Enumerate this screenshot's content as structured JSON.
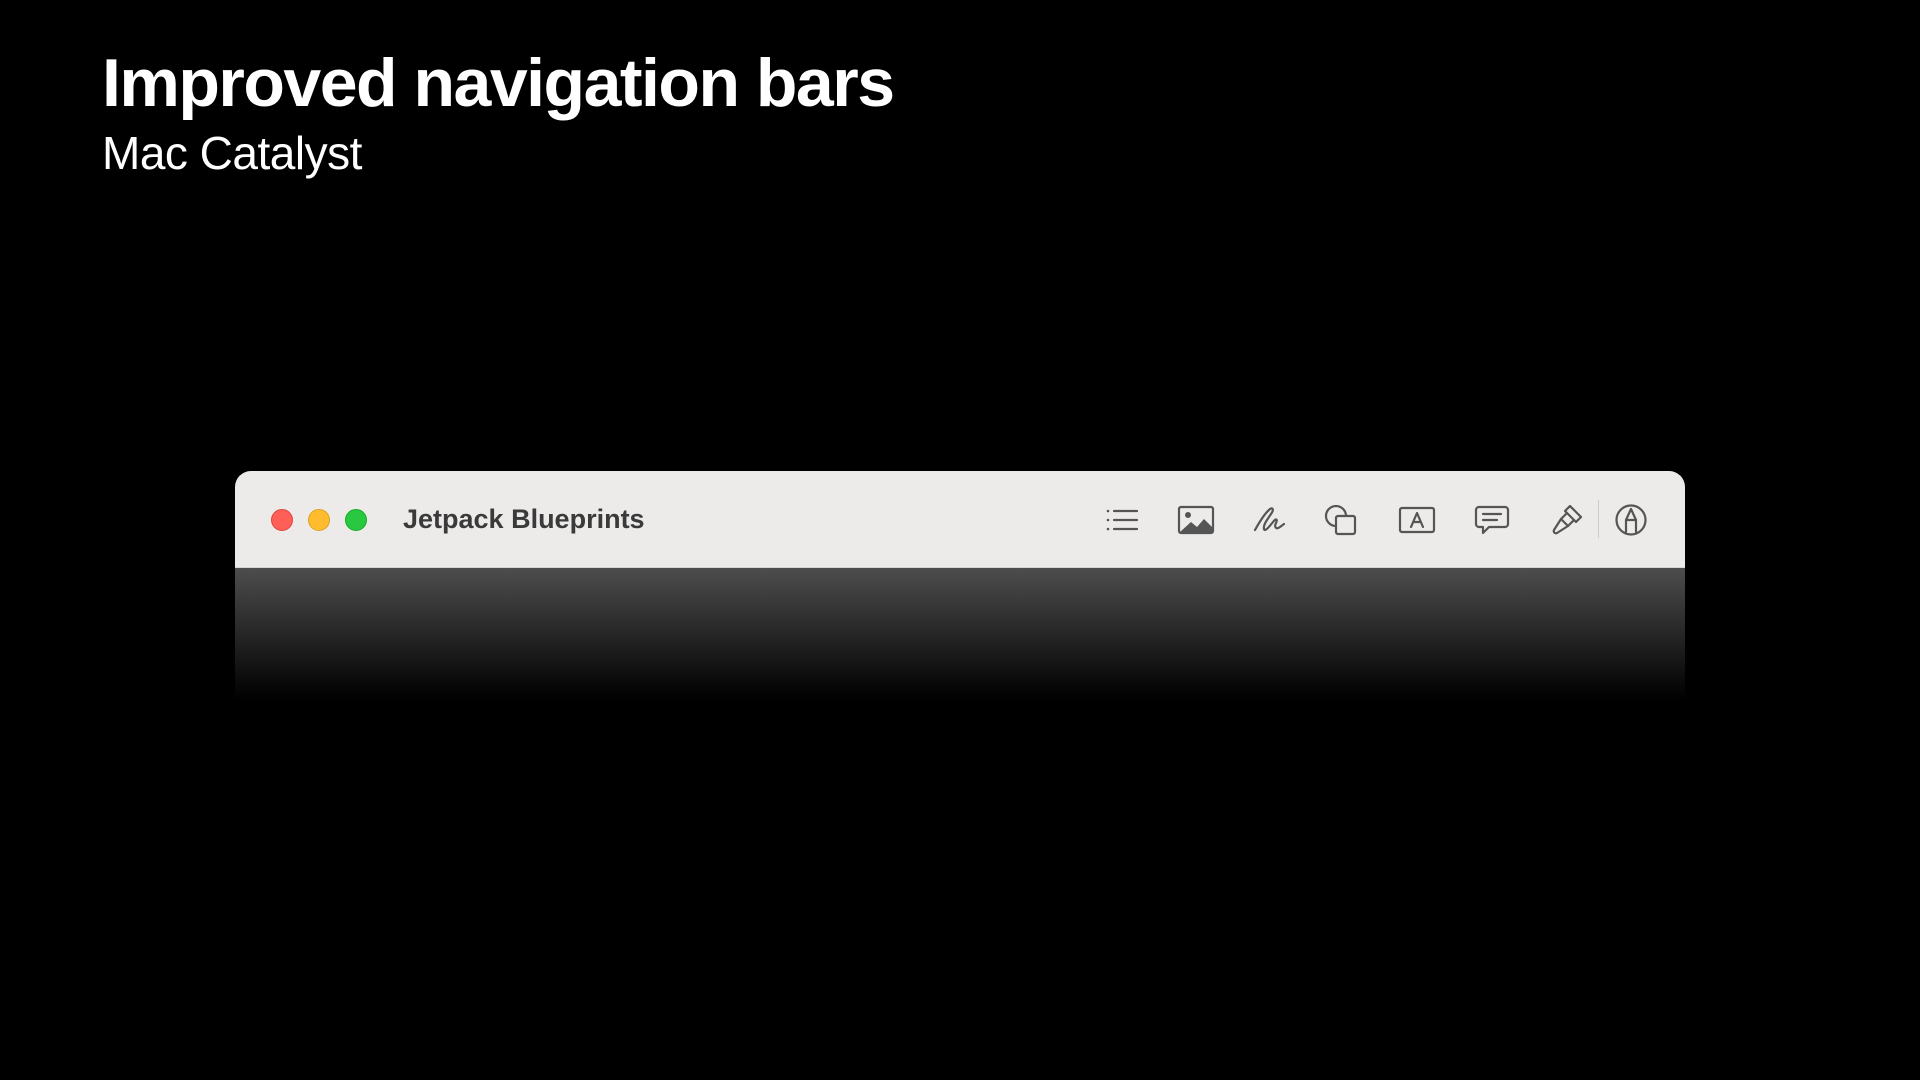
{
  "slide": {
    "title": "Improved navigation bars",
    "subtitle": "Mac Catalyst"
  },
  "window": {
    "title": "Jetpack Blueprints",
    "traffic_lights": [
      {
        "name": "close",
        "color": "#fe5f57"
      },
      {
        "name": "minimize",
        "color": "#febc2e"
      },
      {
        "name": "zoom",
        "color": "#28c840"
      }
    ],
    "toolbar": {
      "icons": [
        "list-icon",
        "photo-icon",
        "scribble-icon",
        "shapes-icon",
        "text-box-icon",
        "comment-icon",
        "paintbrush-icon",
        "markup-icon"
      ]
    }
  },
  "colors": {
    "background": "#000000",
    "titlebar": "#ecebea",
    "icon": "#555555"
  }
}
